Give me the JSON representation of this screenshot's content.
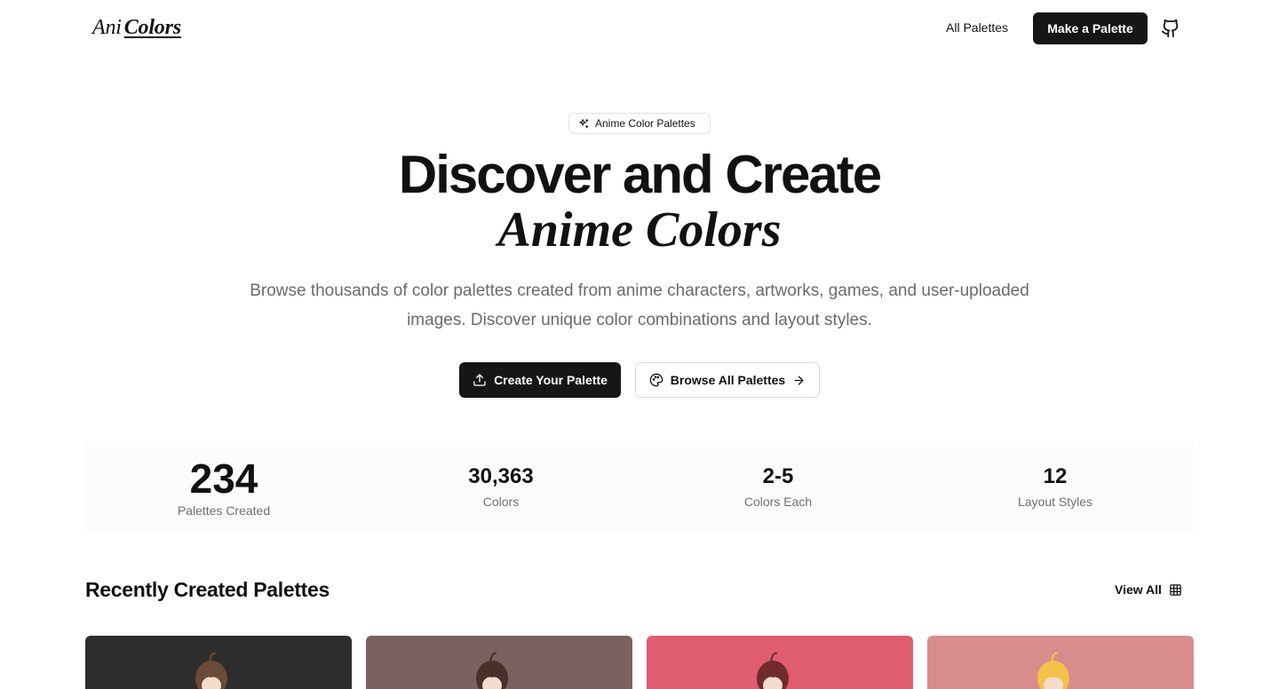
{
  "header": {
    "logo_part1": "Ani",
    "logo_part2": "Colors",
    "nav_all_palettes": "All Palettes",
    "make_palette": "Make a Palette",
    "github_icon": "github-icon"
  },
  "hero": {
    "badge": "Anime Color Palettes",
    "title_line1": "Discover and Create",
    "title_line2": "Anime Colors",
    "subtitle": "Browse thousands of color palettes created from anime characters, artworks, games, and user-uploaded images. Discover unique color combinations and layout styles.",
    "primary_button": "Create Your Palette",
    "secondary_button": "Browse All Palettes"
  },
  "stats": [
    {
      "value": "234",
      "label": "Palettes Created"
    },
    {
      "value": "30,363",
      "label": "Colors"
    },
    {
      "value": "2-5",
      "label": "Colors Each"
    },
    {
      "value": "12",
      "label": "Layout Styles"
    }
  ],
  "recent": {
    "title": "Recently Created Palettes",
    "view_all": "View All",
    "cards": [
      {
        "bg": "#2d2d2d",
        "hair": "#6b4a36"
      },
      {
        "bg": "#7b6160",
        "hair": "#4a2f2a"
      },
      {
        "bg": "#e05c70",
        "hair": "#6e2c2c"
      },
      {
        "bg": "#d98c8c",
        "hair": "#f2c24a"
      }
    ]
  }
}
